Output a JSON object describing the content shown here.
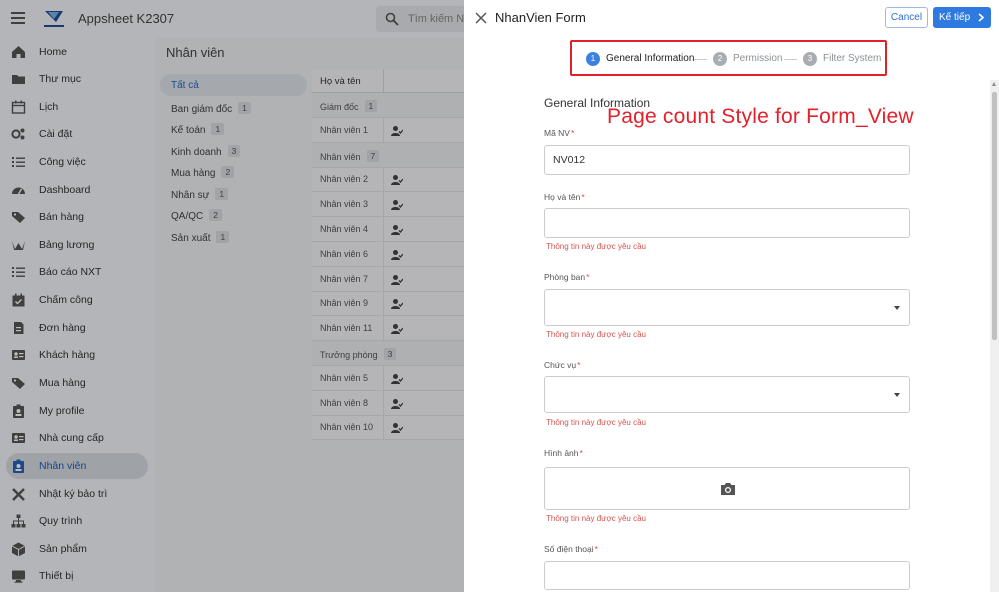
{
  "app": {
    "title": "Appsheet K2307",
    "search_placeholder": "Tìm kiếm Nhâ"
  },
  "sidebar": {
    "items": [
      {
        "label": "Home",
        "icon": "home-icon"
      },
      {
        "label": "Thư mục",
        "icon": "folder-icon"
      },
      {
        "label": "Lịch",
        "icon": "calendar-icon"
      },
      {
        "label": "Cài đặt",
        "icon": "settings-icon"
      },
      {
        "label": "Công việc",
        "icon": "tasks-icon"
      },
      {
        "label": "Dashboard",
        "icon": "dashboard-icon"
      },
      {
        "label": "Bán hàng",
        "icon": "tag-icon"
      },
      {
        "label": "Bảng lương",
        "icon": "payroll-icon"
      },
      {
        "label": "Báo cáo NXT",
        "icon": "report-list-icon"
      },
      {
        "label": "Chấm công",
        "icon": "calendar-check-icon"
      },
      {
        "label": "Đơn hàng",
        "icon": "order-icon"
      },
      {
        "label": "Khách hàng",
        "icon": "contact-card-icon"
      },
      {
        "label": "Mua hàng",
        "icon": "tags-icon"
      },
      {
        "label": "My profile",
        "icon": "profile-badge-icon"
      },
      {
        "label": "Nhà cung cấp",
        "icon": "supplier-card-icon"
      },
      {
        "label": "Nhân viên",
        "icon": "employee-badge-icon",
        "active": true
      },
      {
        "label": "Nhật ký bảo trì",
        "icon": "tools-icon"
      },
      {
        "label": "Quy trình",
        "icon": "sitemap-icon"
      },
      {
        "label": "Sản phẩm",
        "icon": "box-icon"
      },
      {
        "label": "Thiết bị",
        "icon": "monitor-icon"
      }
    ]
  },
  "content": {
    "title": "Nhân viên",
    "groups": [
      {
        "label": "Tất cả",
        "count": ""
      },
      {
        "label": "Ban giám đốc",
        "count": "1"
      },
      {
        "label": "Kế toán",
        "count": "1"
      },
      {
        "label": "Kinh doanh",
        "count": "3"
      },
      {
        "label": "Mua hàng",
        "count": "2"
      },
      {
        "label": "Nhân sự",
        "count": "1"
      },
      {
        "label": "QA/QC",
        "count": "2"
      },
      {
        "label": "Sản xuất",
        "count": "1"
      }
    ],
    "table": {
      "header": "Họ và tên",
      "rows": [
        {
          "label": "Giám đốc",
          "count": "1",
          "group": true
        },
        {
          "label": "Nhân viên 1"
        },
        {
          "label": "Nhân viên",
          "count": "7",
          "group": true
        },
        {
          "label": "Nhân viên 2"
        },
        {
          "label": "Nhân viên 3"
        },
        {
          "label": "Nhân viên 4"
        },
        {
          "label": "Nhân viên 6"
        },
        {
          "label": "Nhân viên 7"
        },
        {
          "label": "Nhân viên 9"
        },
        {
          "label": "Nhân viên 11"
        },
        {
          "label": "Trưởng phòng",
          "count": "3",
          "group": true
        },
        {
          "label": "Nhân viên 5"
        },
        {
          "label": "Nhân viên 8"
        },
        {
          "label": "Nhân viên 10"
        }
      ]
    }
  },
  "form": {
    "title": "NhanVien Form",
    "cancel_label": "Cancel",
    "next_label": "Kế tiếp",
    "steps": [
      {
        "number": "1",
        "label": "General Information",
        "active": true
      },
      {
        "number": "2",
        "label": "Permission",
        "active": false
      },
      {
        "number": "3",
        "label": "Filter System",
        "active": false
      }
    ],
    "section_title": "General Information",
    "annotation": "Page count Style for Form_View",
    "required_mark": "*",
    "fields": [
      {
        "label": "Mã NV",
        "value": "NV012",
        "type": "text",
        "error": ""
      },
      {
        "label": "Họ và tên",
        "value": "",
        "type": "text",
        "error": "Thông tin này được yêu cầu"
      },
      {
        "label": "Phòng ban",
        "value": "",
        "type": "dropdown",
        "error": "Thông tin này được yêu cầu"
      },
      {
        "label": "Chức vụ",
        "value": "",
        "type": "dropdown",
        "error": "Thông tin này được yêu cầu"
      },
      {
        "label": "Hình ảnh",
        "value": "",
        "type": "image",
        "error": "Thông tin này được yêu cầu"
      },
      {
        "label": "Số điện thoại",
        "value": "",
        "type": "text",
        "error": ""
      }
    ]
  },
  "colors": {
    "accent": "#2f7ae0",
    "annotation_red": "#e4202b",
    "error_red": "#d9534f"
  }
}
